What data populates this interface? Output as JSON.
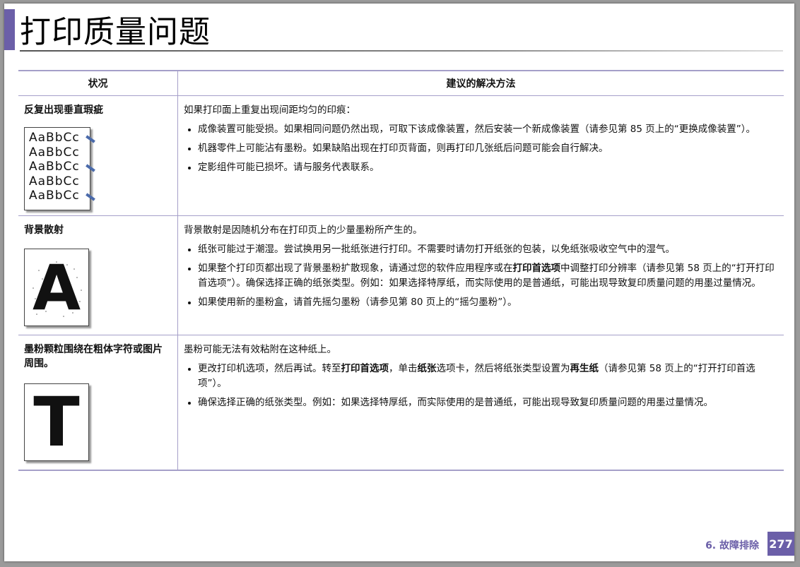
{
  "page": {
    "title": "打印质量问题",
    "footer_section": "6.  故障排除",
    "page_number": "277"
  },
  "table": {
    "headers": [
      "状况",
      "建议的解决方法"
    ],
    "rows": [
      {
        "condition": "反复出现垂直瑕疵",
        "sample_lines": [
          "AaBbCc",
          "AaBbCc",
          "AaBbCc",
          "AaBbCc",
          "AaBbCc"
        ],
        "lead": "如果打印面上重复出现间距均匀的印痕：",
        "bullets": [
          [
            "成像装置可能受损。如果相同问题仍然出现，可取下该成像装置，然后安装一个新成像装置（请参见第 85 页上的“更换成像装置”）。"
          ],
          [
            "机器零件上可能沾有墨粉。如果缺陷出现在打印页背面，则再打印几张纸后问题可能会自行解决。"
          ],
          [
            "定影组件可能已损坏。请与服务代表联系。"
          ]
        ]
      },
      {
        "condition": "背景散射",
        "sample_glyph": "A",
        "lead": "背景散射是因随机分布在打印页上的少量墨粉所产生的。",
        "bullets": [
          [
            "纸张可能过于潮湿。尝试换用另一批纸张进行打印。不需要时请勿打开纸张的包装，以免纸张吸收空气中的湿气。"
          ],
          [
            "如果整个打印页都出现了背景墨粉扩散现象，请通过您的软件应用程序或在",
            "打印首选项",
            "中调整打印分辨率（请参见第 58 页上的“打开打印首选项”）。确保选择正确的纸张类型。例如：如果选择特厚纸，而实际使用的是普通纸，可能出现导致复印质量问题的用墨过量情况。"
          ],
          [
            "如果使用新的墨粉盒，请首先摇匀墨粉（请参见第 80 页上的“摇匀墨粉”）。"
          ]
        ]
      },
      {
        "condition": "墨粉颗粒围绕在粗体字符或图片周围。",
        "sample_glyph": "T",
        "lead": "墨粉可能无法有效粘附在这种纸上。",
        "bullets": [
          [
            "更改打印机选项，然后再试。转至",
            "打印首选项",
            "，单击",
            "纸张",
            "选项卡，然后将纸张类型设置为",
            "再生纸",
            "（请参见第 58 页上的“打开打印首选项”）。"
          ],
          [
            "确保选择正确的纸张类型。例如：如果选择特厚纸，而实际使用的是普通纸，可能出现导致复印质量问题的用墨过量情况。"
          ]
        ]
      }
    ]
  }
}
